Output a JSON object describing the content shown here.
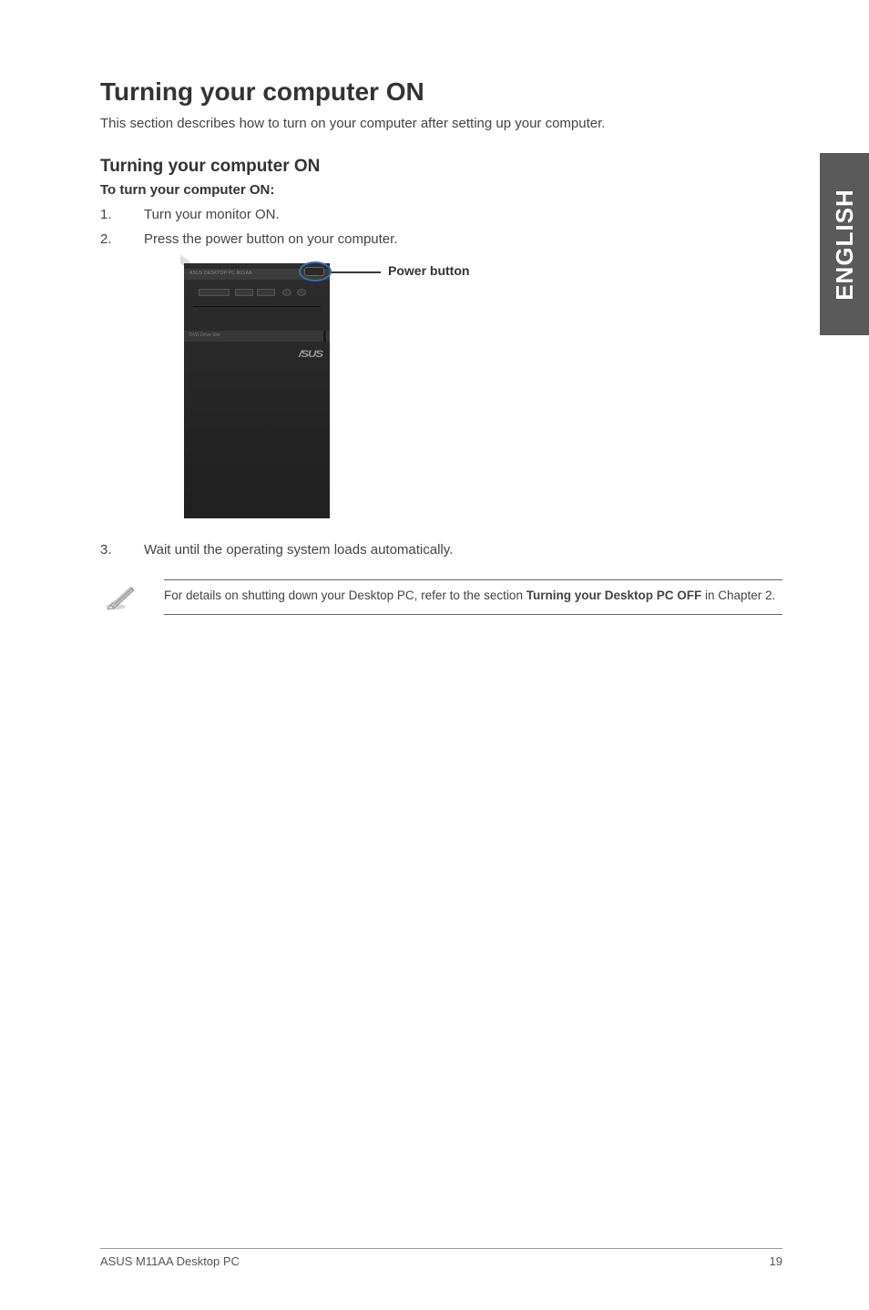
{
  "side_tab": "ENGLISH",
  "h1": "Turning your computer ON",
  "intro": "This section describes how to turn on your computer after setting up your computer.",
  "h2": "Turning your computer ON",
  "lead": "To turn your computer ON:",
  "steps": {
    "s1_num": "1.",
    "s1_text": "Turn your monitor ON.",
    "s2_num": "2.",
    "s2_text": "Press the power button on your computer.",
    "s3_num": "3.",
    "s3_text": "Wait until the operating system loads automatically."
  },
  "callout": "Power button",
  "pc_labels": {
    "top": "ASUS DESKTOP PC M11AA",
    "mid": "DVD Drive Slot",
    "logo": "/SUS"
  },
  "note": {
    "prefix": "For details on shutting down your Desktop PC, refer to the section ",
    "strong": "Turning your Desktop PC OFF",
    "suffix": " in Chapter 2."
  },
  "footer": {
    "left": "ASUS M11AA Desktop PC",
    "right": "19"
  }
}
